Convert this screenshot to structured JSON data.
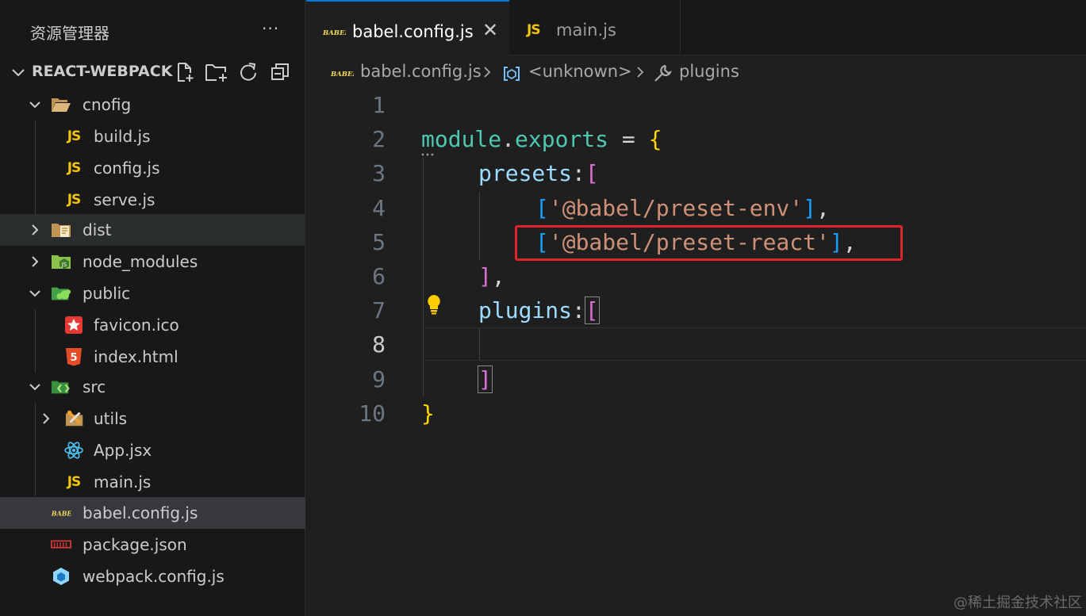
{
  "sidebar": {
    "title": "资源管理器",
    "more_label": "···",
    "project": "REACT-WEBPACK",
    "items": [
      {
        "label": "cnofig",
        "icon": "folder-open-icon"
      },
      {
        "label": "build.js",
        "icon": "js-file-icon"
      },
      {
        "label": "config.js",
        "icon": "js-file-icon"
      },
      {
        "label": "serve.js",
        "icon": "js-file-icon"
      },
      {
        "label": "dist",
        "icon": "folder-dist-icon"
      },
      {
        "label": "node_modules",
        "icon": "folder-node-icon"
      },
      {
        "label": "public",
        "icon": "folder-public-icon"
      },
      {
        "label": "favicon.ico",
        "icon": "favicon-file-icon"
      },
      {
        "label": "index.html",
        "icon": "html-file-icon"
      },
      {
        "label": "src",
        "icon": "folder-src-icon"
      },
      {
        "label": "utils",
        "icon": "folder-utils-icon"
      },
      {
        "label": "App.jsx",
        "icon": "react-file-icon"
      },
      {
        "label": "main.js",
        "icon": "js-file-icon"
      },
      {
        "label": "babel.config.js",
        "icon": "babel-file-icon"
      },
      {
        "label": "package.json",
        "icon": "npm-file-icon"
      },
      {
        "label": "webpack.config.js",
        "icon": "webpack-file-icon"
      }
    ]
  },
  "tabs": [
    {
      "label": "babel.config.js",
      "active": true
    },
    {
      "label": "main.js",
      "active": false
    }
  ],
  "js_badge": "JS",
  "babel_badge": "BABEL",
  "breadcrumb": [
    "babel.config.js",
    "<unknown>",
    "plugins"
  ],
  "editor": {
    "line_numbers": [
      "1",
      "2",
      "3",
      "4",
      "5",
      "6",
      "7",
      "8",
      "9",
      "10"
    ],
    "current_line": "8",
    "tokens": {
      "module": "module",
      "dot": ".",
      "exports": "exports",
      "assign": " = ",
      "lbrace": "{",
      "presets": "presets",
      "colon": ":",
      "lbracket": "[",
      "str_env": "'@babel/preset-env'",
      "str_react": "'@babel/preset-react'",
      "rbracket": "]",
      "comma": ",",
      "plugins": "plugins",
      "rbrace": "}"
    }
  },
  "watermark": "@稀土掘金技术社区",
  "colors": {
    "accent": "#0078d4",
    "highlight_box": "#e0242a",
    "js_yellow": "#f1c40f"
  }
}
